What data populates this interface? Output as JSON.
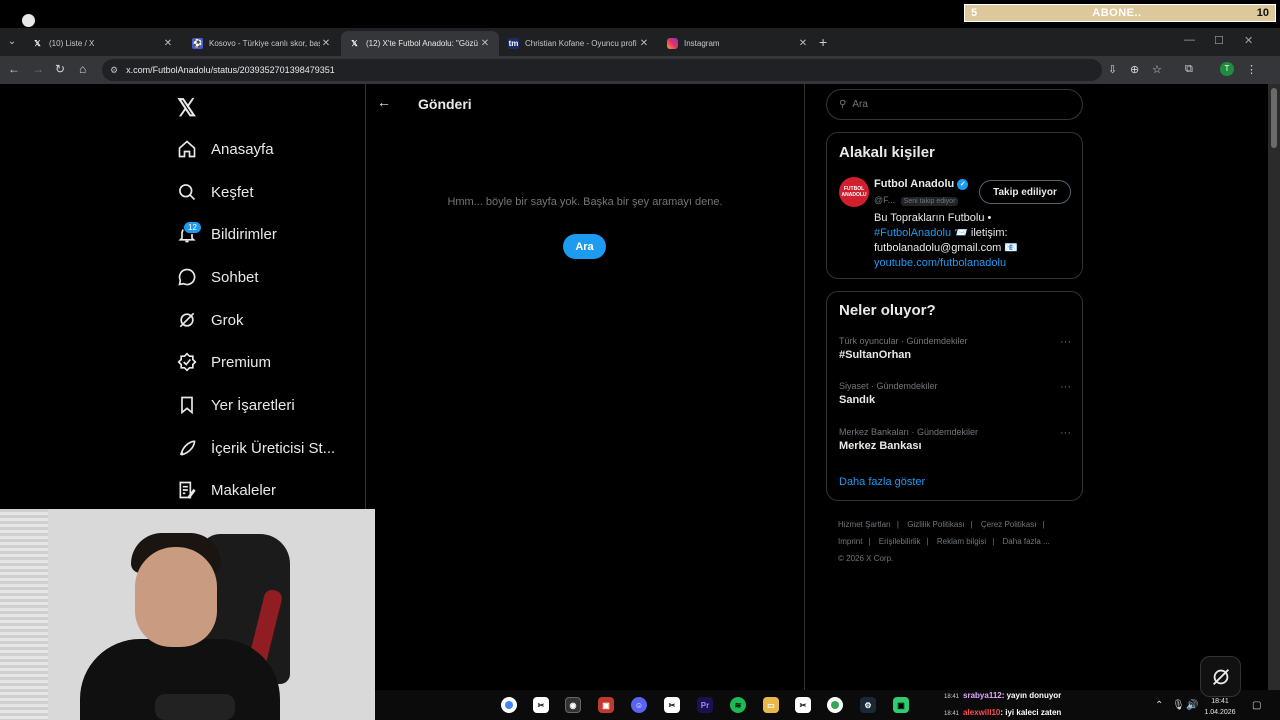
{
  "overlay": {
    "abone_left": "5",
    "abone_label": "ABONE..",
    "abone_right": "10"
  },
  "browser": {
    "tabs": [
      {
        "title": "(10) Liste / X",
        "icon": "x-logo-icon"
      },
      {
        "title": "Kosovo - Türkiye canlı skor, baş",
        "icon": "kosovo-favicon-icon"
      },
      {
        "title": "(12) X'te Futbol Anadolu: \"Gözü",
        "icon": "x-logo-icon",
        "active": true
      },
      {
        "title": "Christian Kofane - Oyuncu profi",
        "icon": "transfermarkt-favicon-icon"
      },
      {
        "title": "Instagram",
        "icon": "instagram-icon"
      }
    ],
    "url": "x.com/FutbolAnadolu/status/2039352701398479351",
    "profile_initial": "T"
  },
  "nav": {
    "items": [
      {
        "label": "Anasayfa",
        "icon": "home-icon"
      },
      {
        "label": "Keşfet",
        "icon": "search-icon"
      },
      {
        "label": "Bildirimler",
        "icon": "bell-icon"
      },
      {
        "label": "Sohbet",
        "icon": "chat-icon"
      },
      {
        "label": "Grok",
        "icon": "grok-icon"
      },
      {
        "label": "Premium",
        "icon": "premium-icon"
      },
      {
        "label": "Yer İşaretleri",
        "icon": "bookmark-icon"
      },
      {
        "label": "İçerik Üreticisi St...",
        "icon": "rocket-icon"
      },
      {
        "label": "Makaleler",
        "icon": "article-icon"
      }
    ],
    "notification_count": "12"
  },
  "main": {
    "title": "Gönderi",
    "not_found_text": "Hmm... böyle bir sayfa yok. Başka bir şey aramayı dene.",
    "search_button": "Ara"
  },
  "sidebar": {
    "search_placeholder": "Ara",
    "related": {
      "heading": "Alakalı kişiler",
      "avatar_text": "FUTBOL ANADOLU",
      "name": "Futbol Anadolu",
      "handle": "@F...",
      "follows_you": "Seni takip ediyor",
      "follow_button": "Takip ediliyor",
      "bio_line1": "Bu Toprakların Futbolu •",
      "bio_hashtag": "#FutbolAnadolu",
      "bio_line2": "📨 iletişim:",
      "bio_email": "futbolanadolu@gmail.com 📧",
      "bio_link": "youtube.com/futbolanadolu"
    },
    "trends": {
      "heading": "Neler oluyor?",
      "items": [
        {
          "context": "Türk oyuncular · Gündemdekiler",
          "name": "#SultanOrhan"
        },
        {
          "context": "Siyaset · Gündemdekiler",
          "name": "Sandık"
        },
        {
          "context": "Merkez Bankaları · Gündemdekiler",
          "name": "Merkez Bankası"
        }
      ],
      "show_more": "Daha fazla göster"
    },
    "footer": {
      "links": [
        "Hizmet Şartları",
        "Gizlilik Politikası",
        "Çerez Politikası",
        "Imprint",
        "Erişilebilirlik",
        "Reklam bilgisi",
        "Daha fazla ..."
      ],
      "copyright": "© 2026 X Corp."
    }
  },
  "chat": [
    {
      "time": "18:41",
      "user": "srabya112",
      "message": ": yayın donuyor"
    },
    {
      "time": "18:41",
      "user": "alexwill10",
      "message": ": iyi kaleci zaten"
    }
  ],
  "system": {
    "time": "18:41",
    "date": "1.04.2026"
  },
  "colors": {
    "accent": "#1d9bf0",
    "background": "#000000",
    "muted": "#71767b",
    "text": "#e7e9ea"
  }
}
